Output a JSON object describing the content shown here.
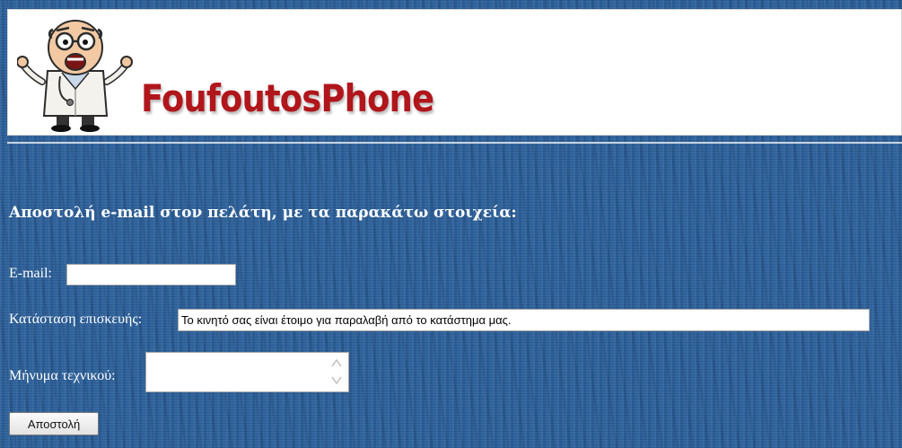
{
  "header": {
    "logo_text": "FoufoutosPhone",
    "mascot_icon": "panicked-doctor-icon"
  },
  "form": {
    "title": "Αποστολή e-mail στον πελάτη, με τα παρακάτω στοιχεία:",
    "email": {
      "label": "E-mail:",
      "value": ""
    },
    "status": {
      "label": "Κατάσταση επισκευής:",
      "value": "Το κινητό σας είναι έτοιμο για παραλαβή από το κατάστημα μας."
    },
    "message": {
      "label": "Μήνυμα τεχνικού:",
      "value": ""
    },
    "submit_label": "Αποστολή"
  },
  "colors": {
    "background": "#2a5f9a",
    "logo": "#b0161b"
  }
}
